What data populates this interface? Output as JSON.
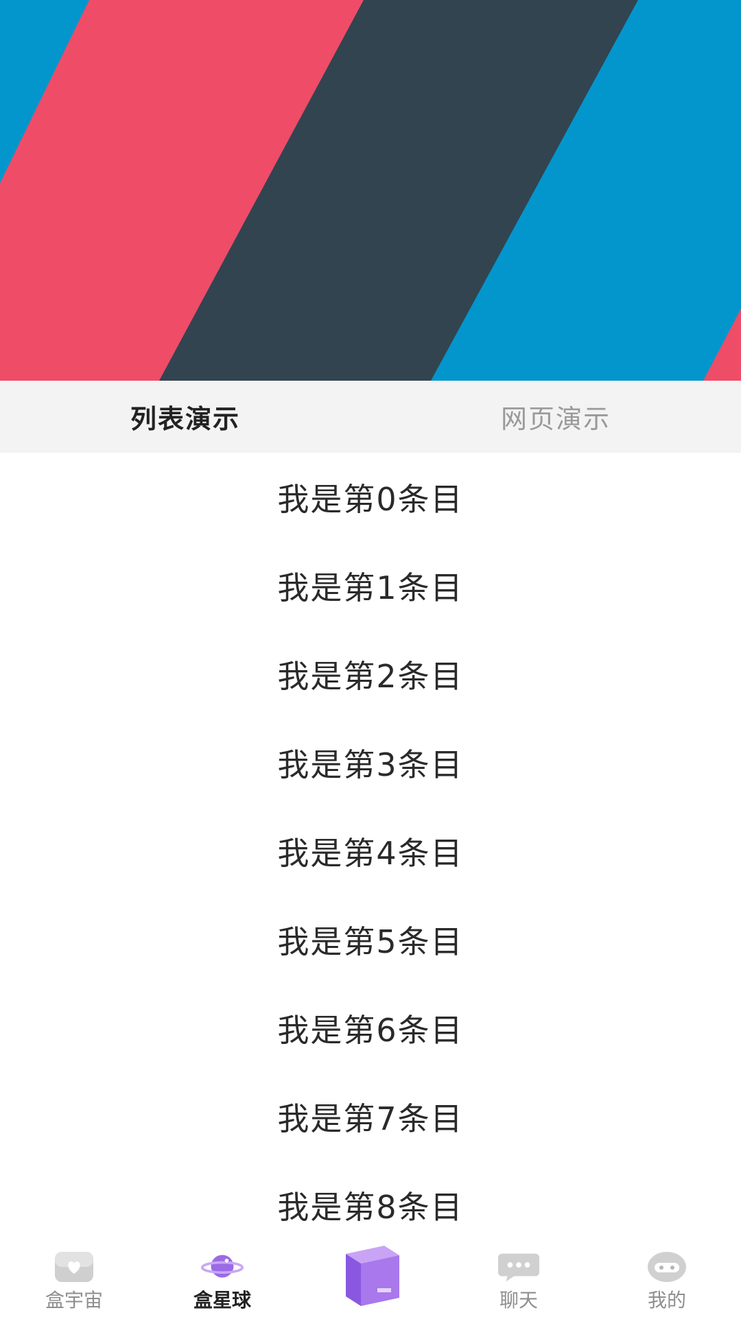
{
  "colors": {
    "stripe_blue": "#0396cc",
    "stripe_red": "#ef4c68",
    "stripe_dark": "#324450",
    "accent_purple": "#9b6ae6"
  },
  "tabs": [
    {
      "label": "列表演示",
      "active": true
    },
    {
      "label": "网页演示",
      "active": false
    }
  ],
  "list": {
    "items": [
      {
        "label": "我是第0条目"
      },
      {
        "label": "我是第1条目"
      },
      {
        "label": "我是第2条目"
      },
      {
        "label": "我是第3条目"
      },
      {
        "label": "我是第4条目"
      },
      {
        "label": "我是第5条目"
      },
      {
        "label": "我是第6条目"
      },
      {
        "label": "我是第7条目"
      },
      {
        "label": "我是第8条目"
      }
    ]
  },
  "bottom_nav": {
    "items": [
      {
        "label": "盒宇宙",
        "icon": "heart-box-icon",
        "active": false
      },
      {
        "label": "盒星球",
        "icon": "planet-icon",
        "active": true
      },
      {
        "label": "",
        "icon": "purple-box-icon",
        "active": false
      },
      {
        "label": "聊天",
        "icon": "chat-bubble-icon",
        "active": false
      },
      {
        "label": "我的",
        "icon": "face-icon",
        "active": false
      }
    ]
  }
}
